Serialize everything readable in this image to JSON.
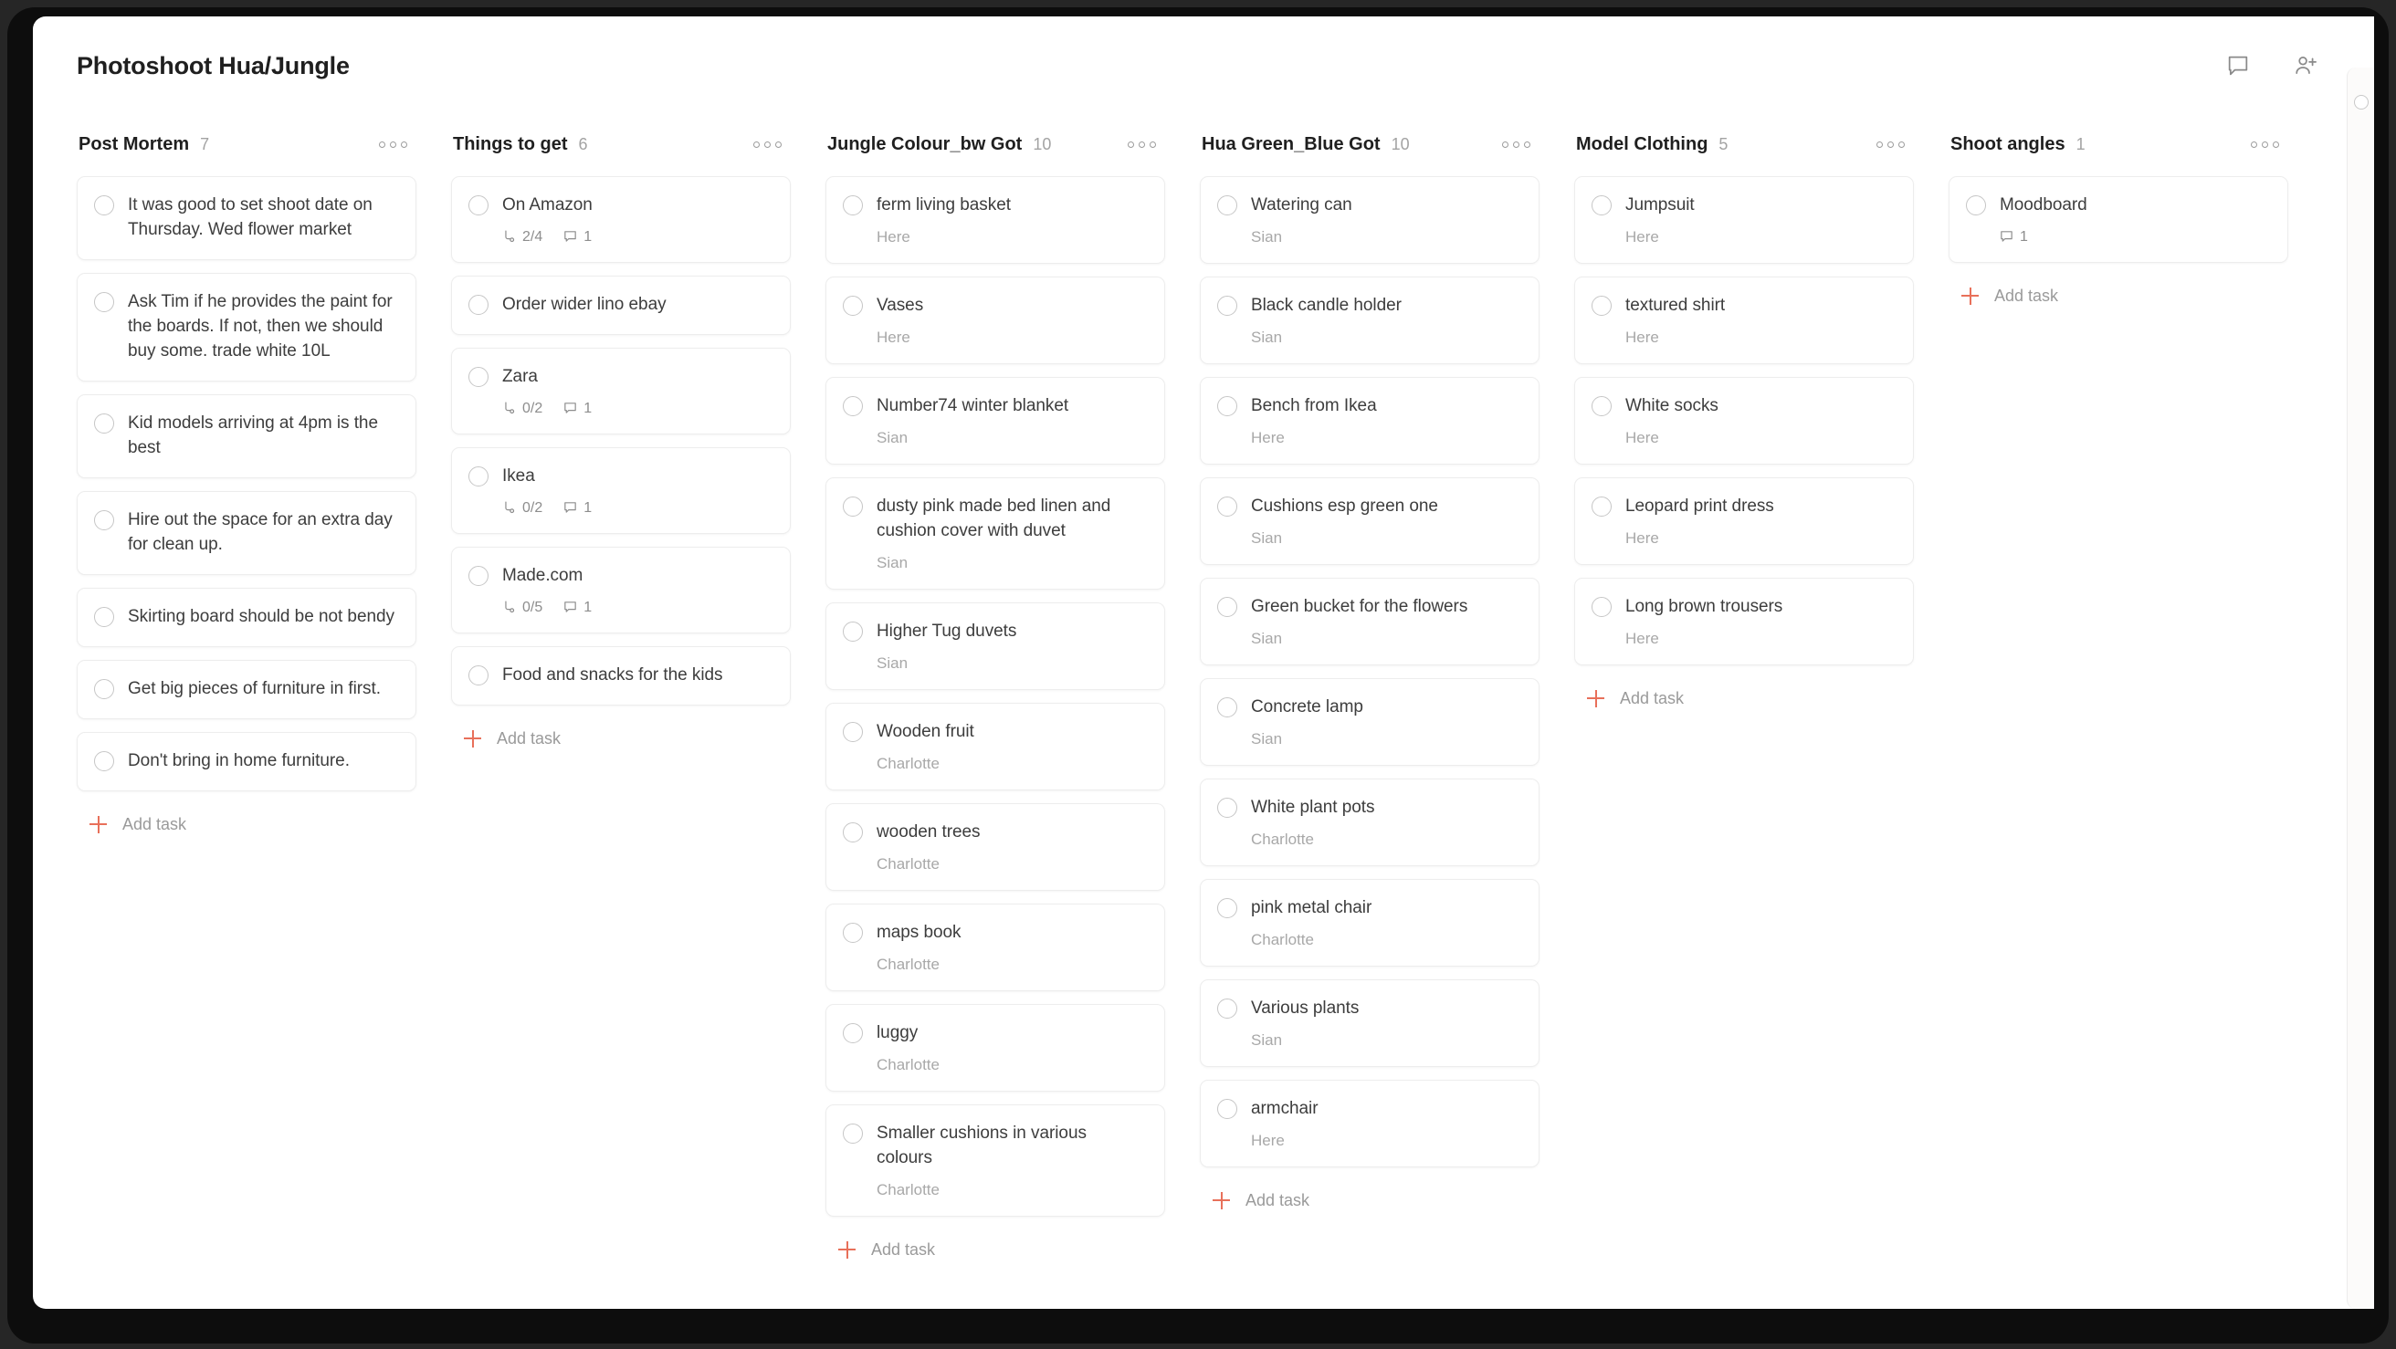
{
  "window": {
    "title": "Photoshoot Hua/Jungle",
    "accent_color": "#e8705a",
    "topbar_icons": [
      {
        "name": "comment-icon",
        "label": "Comments"
      },
      {
        "name": "add-person-icon",
        "label": "Share"
      }
    ]
  },
  "board": {
    "add_task_label": "Add task",
    "columns": [
      {
        "title": "Post Mortem",
        "count": "7",
        "cards": [
          {
            "title": "It was good to set shoot date on Thursday. Wed flower market"
          },
          {
            "title": "Ask Tim if he provides the paint for the boards. If not, then we should buy some. trade white 10L"
          },
          {
            "title": "Kid models arriving at 4pm is the best"
          },
          {
            "title": "Hire out the space for an extra day for clean up."
          },
          {
            "title": "Skirting board should be not bendy"
          },
          {
            "title": "Get big pieces of furniture in first."
          },
          {
            "title": "Don't bring in home furniture."
          }
        ]
      },
      {
        "title": "Things to get",
        "count": "6",
        "cards": [
          {
            "title": "On Amazon",
            "subtasks": "2/4",
            "comments": "1"
          },
          {
            "title": "Order wider lino ebay"
          },
          {
            "title": "Zara",
            "subtasks": "0/2",
            "comments": "1"
          },
          {
            "title": "Ikea",
            "subtasks": "0/2",
            "comments": "1"
          },
          {
            "title": "Made.com",
            "subtasks": "0/5",
            "comments": "1"
          },
          {
            "title": "Food and snacks for the kids"
          }
        ]
      },
      {
        "title": "Jungle Colour_bw Got",
        "count": "10",
        "cards": [
          {
            "title": "ferm living basket",
            "sub": "Here"
          },
          {
            "title": "Vases",
            "sub": "Here"
          },
          {
            "title": "Number74 winter blanket",
            "sub": "Sian"
          },
          {
            "title": "dusty pink made bed linen and cushion cover with duvet",
            "sub": "Sian"
          },
          {
            "title": "Higher Tug duvets",
            "sub": "Sian"
          },
          {
            "title": "Wooden fruit",
            "sub": "Charlotte"
          },
          {
            "title": "wooden trees",
            "sub": "Charlotte"
          },
          {
            "title": "maps book",
            "sub": "Charlotte"
          },
          {
            "title": "luggy",
            "sub": "Charlotte"
          },
          {
            "title": "Smaller cushions in various colours",
            "sub": "Charlotte"
          }
        ]
      },
      {
        "title": "Hua Green_Blue Got",
        "count": "10",
        "cards": [
          {
            "title": "Watering can",
            "sub": "Sian"
          },
          {
            "title": "Black candle holder",
            "sub": "Sian"
          },
          {
            "title": "Bench from Ikea",
            "sub": "Here"
          },
          {
            "title": "Cushions esp green one",
            "sub": "Sian"
          },
          {
            "title": "Green bucket for the flowers",
            "sub": "Sian"
          },
          {
            "title": "Concrete lamp",
            "sub": "Sian"
          },
          {
            "title": "White plant pots",
            "sub": "Charlotte"
          },
          {
            "title": "pink metal chair",
            "sub": "Charlotte"
          },
          {
            "title": "Various plants",
            "sub": "Sian"
          },
          {
            "title": "armchair",
            "sub": "Here"
          }
        ]
      },
      {
        "title": "Model Clothing",
        "count": "5",
        "cards": [
          {
            "title": "Jumpsuit",
            "sub": "Here"
          },
          {
            "title": "textured shirt",
            "sub": "Here"
          },
          {
            "title": "White socks",
            "sub": "Here"
          },
          {
            "title": "Leopard print dress",
            "sub": "Here"
          },
          {
            "title": "Long brown trousers",
            "sub": "Here"
          }
        ]
      },
      {
        "title": "Shoot angles",
        "count": "1",
        "cards": [
          {
            "title": "Moodboard",
            "comments": "1"
          }
        ]
      }
    ]
  }
}
